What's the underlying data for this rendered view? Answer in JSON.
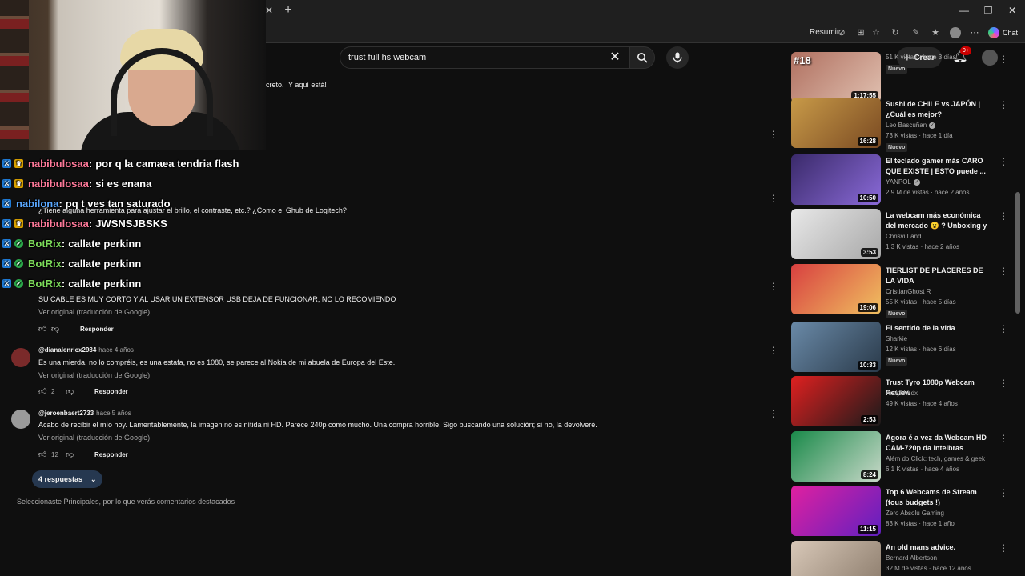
{
  "browser": {
    "summarize_label": "Resumir",
    "chat_label": "Chat",
    "tab_close": "✕",
    "new_tab": "+"
  },
  "header": {
    "search_value": "trust full hs webcam",
    "create_label": "Crear",
    "notifications_badge": "9+"
  },
  "comments": {
    "fragments": [
      "creto. ¡Y aquí está!",
      "¿Tiene alguna herramienta para ajustar el brillo, el contraste, etc.? ¿Como el Ghub de Logitech?"
    ],
    "items": [
      {
        "author": "",
        "time": "",
        "body": "SU CABLE ES MUY CORTO Y AL USAR UN EXTENSOR USB DEJA DE FUNCIONAR, NO LO RECOMIENDO",
        "translate": "Ver original (traducción de Google)",
        "likes": "",
        "reply": "Responder"
      },
      {
        "author": "@dianalenricx2984",
        "time": "hace 4 años",
        "body": "Es una mierda, no lo compréis, es una estafa, no es 1080, se parece al Nokia de mi abuela de Europa del Este.",
        "translate": "Ver original (traducción de Google)",
        "likes": "2",
        "reply": "Responder"
      },
      {
        "author": "@jeroenbaert2733",
        "time": "hace 5 años",
        "body": "Acabo de recibir el mío hoy. Lamentablemente, la imagen no es nítida ni HD. Parece 240p como mucho. Una compra horrible. Sigo buscando una solución; si no, la devolveré.",
        "translate": "Ver original (traducción de Google)",
        "likes": "12",
        "reply": "Responder"
      }
    ],
    "replies_label": "4 respuestas",
    "sort_note": "Seleccionaste Principales, por lo que verás comentarios destacados"
  },
  "chat": [
    {
      "user": "nabibulosaa",
      "message": "por q la camaea tendria flash",
      "color": "#ff7a9a",
      "badge": "crown"
    },
    {
      "user": "nabibulosaa",
      "message": "si es enana",
      "color": "#ff7a9a",
      "badge": "crown"
    },
    {
      "user": "nabilona",
      "message": "pq t ves tan saturado",
      "color": "#5aa8ff",
      "badge": "none"
    },
    {
      "user": "nabibulosaa",
      "message": "JWSNSJBSKS",
      "color": "#ff7a9a",
      "badge": "crown"
    },
    {
      "user": "BotRix",
      "message": "callate perkinn",
      "color": "#7cdc5a",
      "badge": "verified"
    },
    {
      "user": "BotRix",
      "message": "callate perkinn",
      "color": "#7cdc5a",
      "badge": "verified"
    },
    {
      "user": "BotRix",
      "message": "callate perkinn",
      "color": "#7cdc5a",
      "badge": "verified"
    }
  ],
  "sidebar": {
    "videos": [
      {
        "title": "",
        "channel": "",
        "verified": false,
        "meta": "51 K vistas · hace 3 días",
        "new": "Nuevo",
        "duration": "1:17:55",
        "tag": "#18",
        "thumb": "linear-gradient(135deg,#b07060,#e0c0b0)"
      },
      {
        "title": "Sushi de CHILE vs JAPÓN | ¿Cuál es mejor?",
        "channel": "Leo Bascuñan",
        "verified": true,
        "meta": "73 K vistas · hace 1 día",
        "new": "Nuevo",
        "duration": "16:28",
        "tag": "",
        "thumb": "linear-gradient(135deg,#c89a48,#7a4a22)"
      },
      {
        "title": "El teclado gamer más CARO QUE EXISTE | ESTO puede ...",
        "channel": "YANPOL",
        "verified": true,
        "meta": "2.9 M de vistas · hace 2 años",
        "new": "",
        "duration": "10:50",
        "tag": "",
        "thumb": "linear-gradient(135deg,#3a2a6a,#8a6ad8)"
      },
      {
        "title": "La webcam más económica del mercado 😮 ? Unboxing y ...",
        "channel": "Chrisvi Land",
        "verified": false,
        "meta": "1.3 K vistas · hace 2 años",
        "new": "",
        "duration": "3:53",
        "tag": "",
        "thumb": "linear-gradient(135deg,#e8e8e8,#a8a8a8)"
      },
      {
        "title": "TIERLIST DE PLACERES DE LA VIDA",
        "channel": "CristianGhost R",
        "verified": false,
        "meta": "55 K vistas · hace 5 días",
        "new": "Nuevo",
        "duration": "19:06",
        "tag": "",
        "thumb": "linear-gradient(135deg,#d84040,#f0c060)"
      },
      {
        "title": "El sentido de la vida",
        "channel": "Sharkie",
        "verified": false,
        "meta": "12 K vistas · hace 6 días",
        "new": "Nuevo",
        "duration": "10:33",
        "tag": "",
        "thumb": "linear-gradient(135deg,#6a8aa8,#2a3a4a)"
      },
      {
        "title": "Trust Tyro 1080p Webcam Review",
        "channel": "Andyhhhdx",
        "verified": false,
        "meta": "49 K vistas · hace 4 años",
        "new": "",
        "duration": "2:53",
        "tag": "",
        "thumb": "linear-gradient(135deg,#e02020,#1a1a1a)"
      },
      {
        "title": "Agora é a vez da Webcam HD CAM-720p da Intelbras",
        "channel": "Além do Click: tech, games & geek",
        "verified": false,
        "meta": "6.1 K vistas · hace 4 años",
        "new": "",
        "duration": "8:24",
        "tag": "",
        "thumb": "linear-gradient(135deg,#1a8a4a,#c8d8c8)"
      },
      {
        "title": "Top 6 Webcams de Stream (tous budgets !)",
        "channel": "Zero Absolu Gaming",
        "verified": false,
        "meta": "83 K vistas · hace 1 año",
        "new": "",
        "duration": "11:15",
        "tag": "",
        "thumb": "linear-gradient(135deg,#e020a0,#6020c0)"
      },
      {
        "title": "An old mans advice.",
        "channel": "Bernard Albertson",
        "verified": false,
        "meta": "32 M de vistas · hace 12 años",
        "new": "",
        "duration": "",
        "tag": "",
        "thumb": "linear-gradient(135deg,#d8c8b8,#8a7a6a)"
      }
    ]
  }
}
